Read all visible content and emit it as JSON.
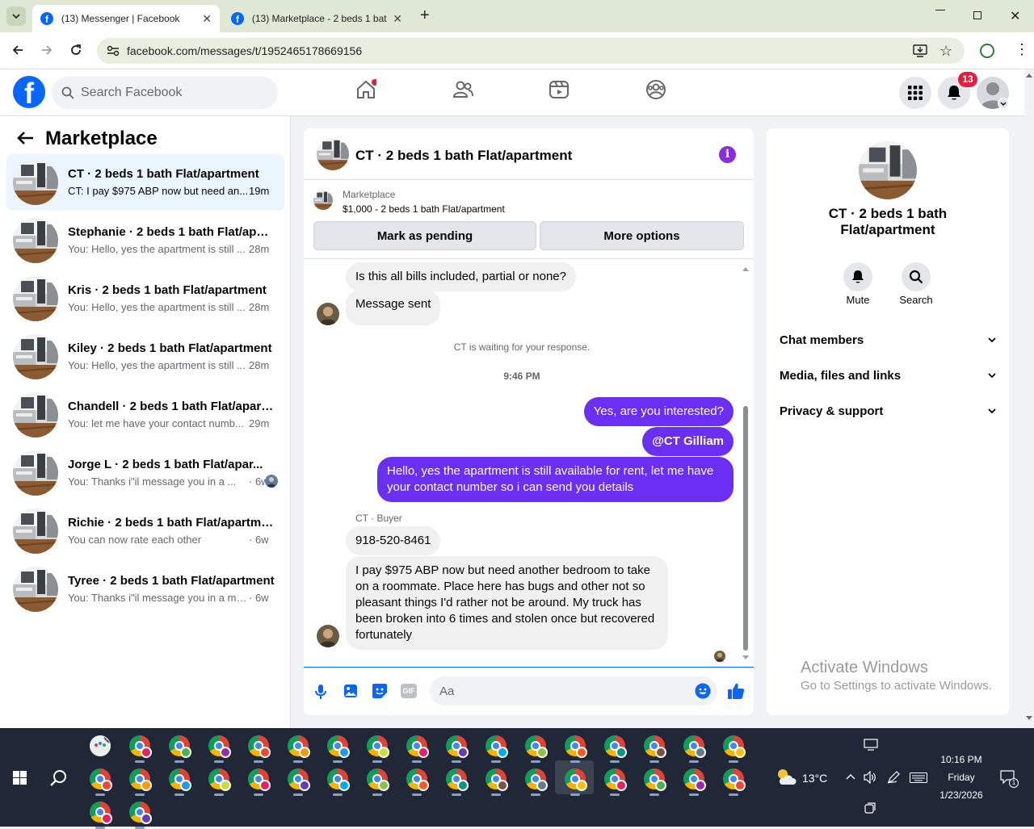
{
  "browser": {
    "tabs": [
      {
        "title": "(13) Messenger | Facebook"
      },
      {
        "title": "(13) Marketplace - 2 beds 1 bat"
      }
    ],
    "url": "facebook.com/messages/t/1952465178669156"
  },
  "fb": {
    "search_placeholder": "Search Facebook",
    "notification_count": "13"
  },
  "sidebar": {
    "title": "Marketplace",
    "conversations": [
      {
        "name": "CT · 2 beds 1 bath Flat/apartment",
        "preview": "CT: I pay $975 ABP now but need an...",
        "time": "19m"
      },
      {
        "name": "Stephanie · 2 beds 1 bath Flat/apar...",
        "preview": "You: Hello, yes the apartment is still ...",
        "time": "28m"
      },
      {
        "name": "Kris · 2 beds 1 bath Flat/apartment",
        "preview": "You: Hello, yes the apartment is still ...",
        "time": "28m"
      },
      {
        "name": "Kiley · 2 beds 1 bath Flat/apartment",
        "preview": "You: Hello, yes the apartment is still ...",
        "time": "28m"
      },
      {
        "name": "Chandell · 2 beds 1 bath Flat/apart...",
        "preview": "You: let me have your contact numb...",
        "time": "29m"
      },
      {
        "name": "Jorge L · 2 beds 1 bath Flat/apar...",
        "preview": "You: Thanks i\"il message you in a ...",
        "time": "· 6w"
      },
      {
        "name": "Richie · 2 beds 1 bath Flat/apartme...",
        "preview": "You can now rate each other",
        "time": "· 6w"
      },
      {
        "name": "Tyree · 2 beds 1 bath Flat/apartment",
        "preview": "You: Thanks i\"il message you in a mo...",
        "time": "· 6w"
      }
    ]
  },
  "chat": {
    "title": "CT · 2 beds 1 bath Flat/apartment",
    "listing_source": "Marketplace",
    "listing_title": "$1,000 - 2 beds 1 bath Flat/apartment",
    "mark_pending_label": "Mark as pending",
    "more_options_label": "More options",
    "messages": {
      "q_bills": "Is this all bills included, partial or none?",
      "message_sent": "Message sent",
      "waiting": "CT is waiting for your response.",
      "timestamp": "9:46 PM",
      "out1": "Yes, are you interested?",
      "out2": "@CT Gilliam",
      "out3": "Hello, yes the apartment is still available for rent, let me have your contact number so i can send you details",
      "sender_label": "CT · Buyer",
      "in_phone": "918-520-8461",
      "in_long": "I pay $975 ABP now but need another bedroom to take on a roommate. Place here has bugs and other not so pleasant things I'd rather not be around. My truck has been broken into 6 times and stolen once but recovered fortunately"
    },
    "composer_placeholder": "Aa"
  },
  "info": {
    "name": "CT · 2 beds 1 bath Flat/apartment",
    "mute_label": "Mute",
    "search_label": "Search",
    "sections": [
      "Chat members",
      "Media, files and links",
      "Privacy & support"
    ]
  },
  "watermark": {
    "line1": "Activate Windows",
    "line2": "Go to Settings to activate Windows."
  },
  "taskbar": {
    "temperature": "13°C",
    "time": "10:16 PM",
    "day": "Friday",
    "date": "1/23/2026",
    "notif_count": "1"
  },
  "colors": {
    "fb_blue": "#0866ff",
    "outgoing_bubble": "#6a2ff2",
    "info_purple": "#8a2be2",
    "notification_red": "#e41e3f"
  }
}
